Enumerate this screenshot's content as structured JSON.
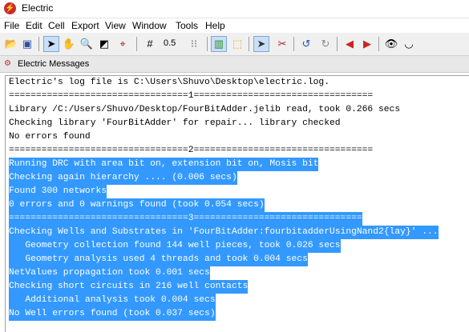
{
  "window": {
    "title": "Electric"
  },
  "menu": [
    "File",
    "Edit",
    "Cell",
    "Export",
    "View",
    "Window",
    "Tools",
    "Help"
  ],
  "toolbar": {
    "grid_value": "0.5"
  },
  "messages": {
    "title": "Electric Messages",
    "lines": [
      "Electric's log file is C:\\Users\\Shuvo\\Desktop\\electric.log.",
      "=================================1=================================",
      "Library /C:/Users/Shuvo/Desktop/FourBitAdder.jelib read, took 0.266 secs",
      "Checking library 'FourBitAdder' for repair... library checked",
      "No errors found",
      "=================================2=================================",
      "Running DRC with area bit on, extension bit on, Mosis bit",
      "Checking again hierarchy .... (0.006 secs)",
      "Found 300 networks",
      "0 errors and 0 warnings found (took 0.054 secs)",
      "=================================3===============================",
      "Checking Wells and Substrates in 'FourBitAdder:fourbitadderUsingNand2{lay}' ...",
      "   Geometry collection found 144 well pieces, took 0.026 secs",
      "   Geometry analysis used 4 threads and took 0.004 secs",
      "NetValues propagation took 0.001 secs",
      "Checking short circuits in 216 well contacts",
      "   Additional analysis took 0.004 secs",
      "No Well errors found (took 0.037 secs)"
    ],
    "selected_from": 6
  }
}
